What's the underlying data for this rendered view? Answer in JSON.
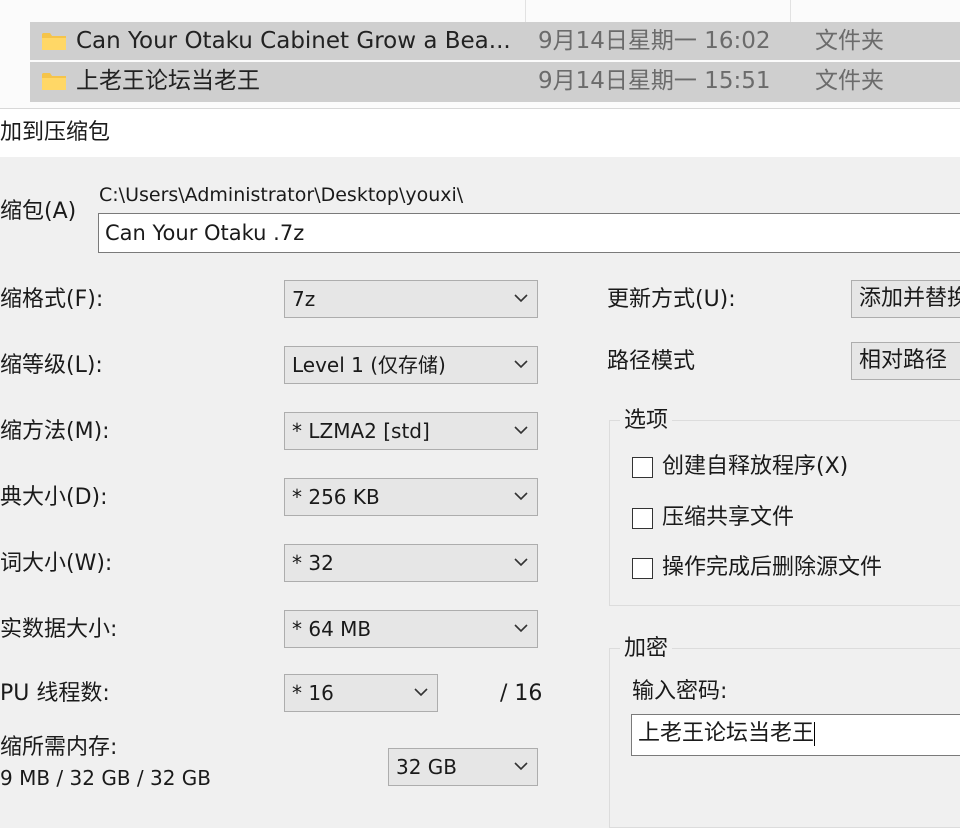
{
  "explorer": {
    "files": [
      {
        "name": "Can Your Otaku Cabinet Grow a Bea...",
        "date": "9月14日星期一 16:02",
        "type": "文件夹"
      },
      {
        "name": "上老王论坛当老王",
        "date": "9月14日星期一 15:51",
        "type": "文件夹"
      }
    ]
  },
  "dialog": {
    "title": "加到压缩包",
    "archive_label": "缩包(A)",
    "archive_path": "C:\\Users\\Administrator\\Desktop\\youxi\\",
    "archive_name": "Can Your Otaku .7z",
    "left": {
      "format": {
        "label": "缩格式(F):",
        "value": "7z"
      },
      "level": {
        "label": "缩等级(L):",
        "value": "Level 1 (仅存储)"
      },
      "method": {
        "label": "缩方法(M):",
        "value": "* LZMA2 [std]"
      },
      "dict": {
        "label": "典大小(D):",
        "value": "* 256 KB"
      },
      "word": {
        "label": "词大小(W):",
        "value": "* 32"
      },
      "solid": {
        "label": "实数据大小:",
        "value": "* 64 MB"
      },
      "threads": {
        "label": "PU 线程数:",
        "value": "* 16",
        "max": "/ 16"
      },
      "memory": {
        "label": "缩所需内存:",
        "detail": "9 MB / 32 GB / 32 GB",
        "value": "32 GB"
      }
    },
    "right": {
      "update": {
        "label": "更新方式(U):",
        "value": "添加并替换"
      },
      "path_mode": {
        "label": "路径模式",
        "value": "相对路径"
      },
      "options": {
        "title": "选项",
        "items": [
          {
            "label": "创建自释放程序(X)",
            "checked": false
          },
          {
            "label": "压缩共享文件",
            "checked": false
          },
          {
            "label": "操作完成后删除源文件",
            "checked": false
          }
        ]
      },
      "encryption": {
        "title": "加密",
        "password_label": "输入密码:",
        "password_value": "上老王论坛当老王"
      }
    }
  },
  "colors": {
    "row_selected": "#cfcfcf",
    "folder": "#f5c44a",
    "window_bg": "#f0f0f0"
  }
}
